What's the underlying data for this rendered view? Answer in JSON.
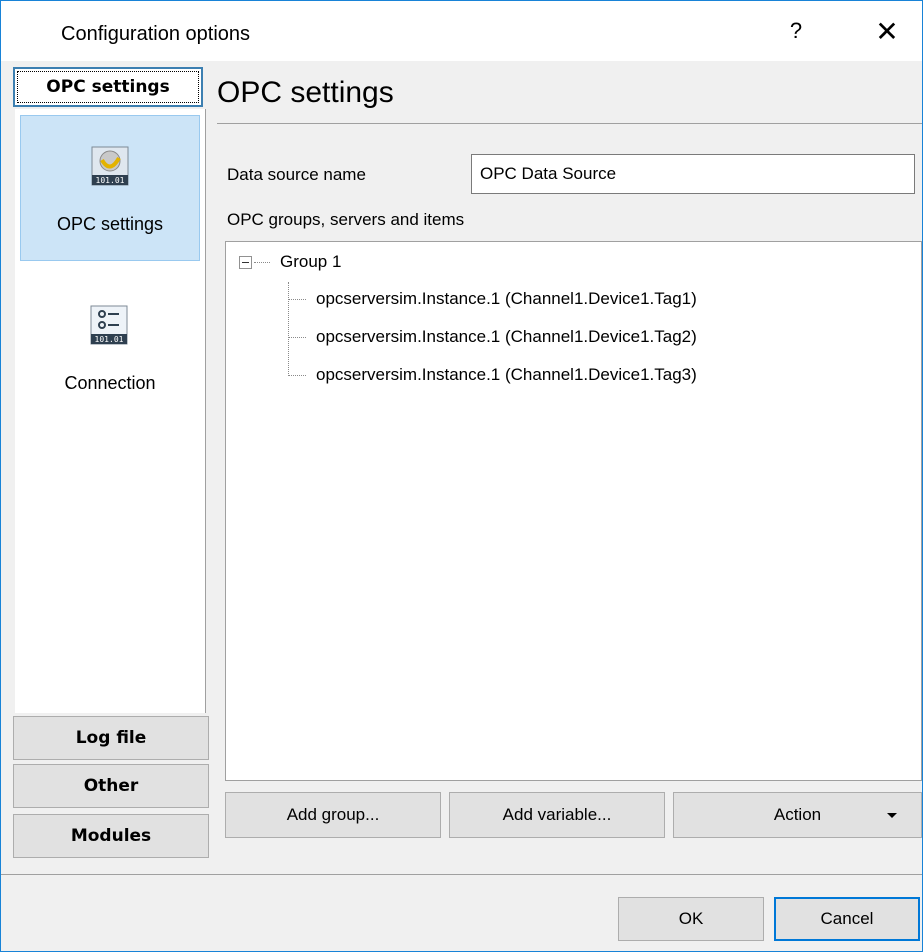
{
  "window": {
    "title": "Configuration options",
    "help_glyph": "?",
    "close_glyph": "✕"
  },
  "nav": {
    "header": "OPC settings",
    "items": [
      {
        "label": "OPC settings",
        "icon": "opc-settings-icon",
        "icon_text": "101.01"
      },
      {
        "label": "Connection",
        "icon": "connection-icon",
        "icon_text": "101.01"
      }
    ],
    "sections": [
      "Log file",
      "Other",
      "Modules"
    ]
  },
  "main": {
    "title": "OPC settings",
    "data_source_label": "Data source name",
    "data_source_value": "OPC Data Source",
    "groups_label": "OPC groups, servers and items",
    "tree": {
      "group": "Group 1",
      "items": [
        "opcserversim.Instance.1 (Channel1.Device1.Tag1)",
        "opcserversim.Instance.1 (Channel1.Device1.Tag2)",
        "opcserversim.Instance.1 (Channel1.Device1.Tag3)"
      ]
    },
    "buttons": {
      "add_group": "Add group...",
      "add_variable": "Add variable...",
      "action": "Action"
    }
  },
  "footer": {
    "ok": "OK",
    "cancel": "Cancel"
  },
  "colors": {
    "accent": "#0078d7",
    "selection": "#cce4f7"
  }
}
